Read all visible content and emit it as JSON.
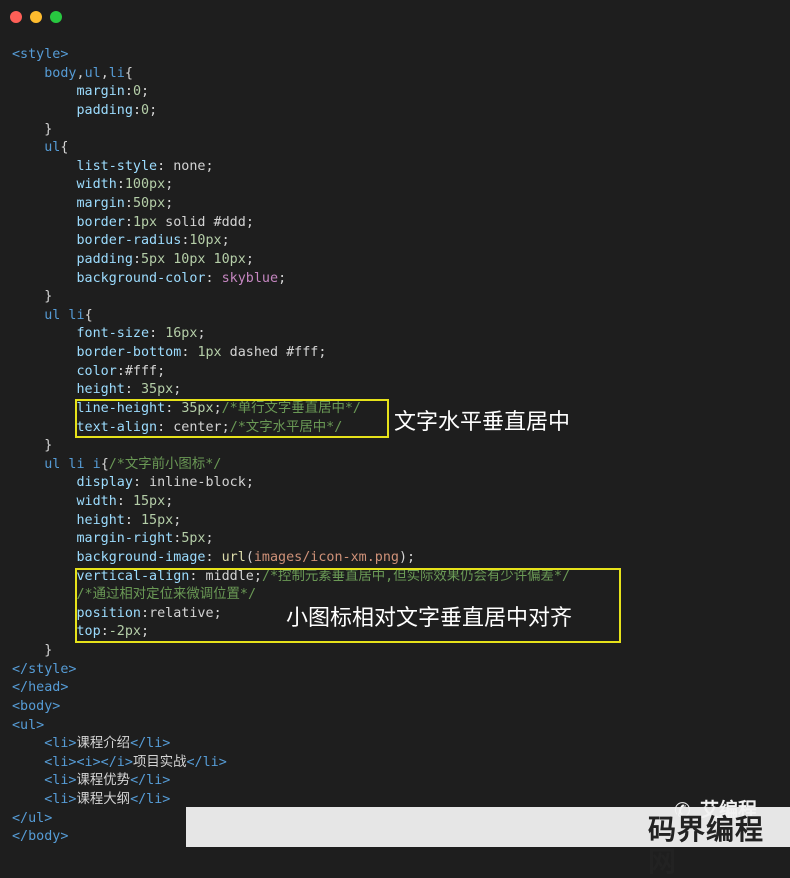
{
  "window": {
    "controls": [
      "close",
      "minimize",
      "maximize"
    ],
    "colors": {
      "close": "#fe5f57",
      "minimize": "#febc2e",
      "maximize": "#28c840",
      "background": "#1e1e1e"
    }
  },
  "code_lines": [
    [
      [
        "tag",
        "<style>"
      ]
    ],
    [
      [
        "txt",
        "    "
      ],
      [
        "sel",
        "body"
      ],
      [
        "punc",
        ","
      ],
      [
        "sel",
        "ul"
      ],
      [
        "punc",
        ","
      ],
      [
        "sel",
        "li"
      ],
      [
        "punc",
        "{"
      ]
    ],
    [
      [
        "txt",
        "        "
      ],
      [
        "prop",
        "margin"
      ],
      [
        "punc",
        ":"
      ],
      [
        "num",
        "0"
      ],
      [
        "punc",
        ";"
      ]
    ],
    [
      [
        "txt",
        "        "
      ],
      [
        "prop",
        "padding"
      ],
      [
        "punc",
        ":"
      ],
      [
        "num",
        "0"
      ],
      [
        "punc",
        ";"
      ]
    ],
    [
      [
        "txt",
        "    "
      ],
      [
        "punc",
        "}"
      ]
    ],
    [
      [
        "txt",
        "    "
      ],
      [
        "sel",
        "ul"
      ],
      [
        "punc",
        "{"
      ]
    ],
    [
      [
        "txt",
        "        "
      ],
      [
        "prop",
        "list-style"
      ],
      [
        "punc",
        ": "
      ],
      [
        "txt",
        "none"
      ],
      [
        "punc",
        ";"
      ]
    ],
    [
      [
        "txt",
        "        "
      ],
      [
        "prop",
        "width"
      ],
      [
        "punc",
        ":"
      ],
      [
        "num",
        "100px"
      ],
      [
        "punc",
        ";"
      ]
    ],
    [
      [
        "txt",
        "        "
      ],
      [
        "prop",
        "margin"
      ],
      [
        "punc",
        ":"
      ],
      [
        "num",
        "50px"
      ],
      [
        "punc",
        ";"
      ]
    ],
    [
      [
        "txt",
        "        "
      ],
      [
        "prop",
        "border"
      ],
      [
        "punc",
        ":"
      ],
      [
        "num",
        "1px"
      ],
      [
        "txt",
        " solid #ddd"
      ],
      [
        "punc",
        ";"
      ]
    ],
    [
      [
        "txt",
        "        "
      ],
      [
        "prop",
        "border-radius"
      ],
      [
        "punc",
        ":"
      ],
      [
        "num",
        "10px"
      ],
      [
        "punc",
        ";"
      ]
    ],
    [
      [
        "txt",
        "        "
      ],
      [
        "prop",
        "padding"
      ],
      [
        "punc",
        ":"
      ],
      [
        "num",
        "5px 10px 10px"
      ],
      [
        "punc",
        ";"
      ]
    ],
    [
      [
        "txt",
        "        "
      ],
      [
        "prop",
        "background-color"
      ],
      [
        "punc",
        ": "
      ],
      [
        "kw",
        "skyblue"
      ],
      [
        "punc",
        ";"
      ]
    ],
    [
      [
        "txt",
        "    "
      ],
      [
        "punc",
        "}"
      ]
    ],
    [
      [
        "txt",
        "    "
      ],
      [
        "sel",
        "ul li"
      ],
      [
        "punc",
        "{"
      ]
    ],
    [
      [
        "txt",
        "        "
      ],
      [
        "prop",
        "font-size"
      ],
      [
        "punc",
        ": "
      ],
      [
        "num",
        "16px"
      ],
      [
        "punc",
        ";"
      ]
    ],
    [
      [
        "txt",
        "        "
      ],
      [
        "prop",
        "border-bottom"
      ],
      [
        "punc",
        ": "
      ],
      [
        "num",
        "1px"
      ],
      [
        "txt",
        " dashed #fff"
      ],
      [
        "punc",
        ";"
      ]
    ],
    [
      [
        "txt",
        "        "
      ],
      [
        "prop",
        "color"
      ],
      [
        "punc",
        ":"
      ],
      [
        "txt",
        "#fff"
      ],
      [
        "punc",
        ";"
      ]
    ],
    [
      [
        "txt",
        "        "
      ],
      [
        "prop",
        "height"
      ],
      [
        "punc",
        ": "
      ],
      [
        "num",
        "35px"
      ],
      [
        "punc",
        ";"
      ]
    ],
    [
      [
        "txt",
        "        "
      ],
      [
        "prop",
        "line-height"
      ],
      [
        "punc",
        ": "
      ],
      [
        "num",
        "35px"
      ],
      [
        "punc",
        ";"
      ],
      [
        "cm",
        "/*单行文字垂直居中*/"
      ]
    ],
    [
      [
        "txt",
        "        "
      ],
      [
        "prop",
        "text-align"
      ],
      [
        "punc",
        ": "
      ],
      [
        "txt",
        "center"
      ],
      [
        "punc",
        ";"
      ],
      [
        "cm",
        "/*文字水平居中*/"
      ]
    ],
    [
      [
        "txt",
        "    "
      ],
      [
        "punc",
        "}"
      ]
    ],
    [
      [
        "txt",
        "    "
      ],
      [
        "sel",
        "ul li i"
      ],
      [
        "punc",
        "{"
      ],
      [
        "cm",
        "/*文字前小图标*/"
      ]
    ],
    [
      [
        "txt",
        "        "
      ],
      [
        "prop",
        "display"
      ],
      [
        "punc",
        ": "
      ],
      [
        "txt",
        "inline-block"
      ],
      [
        "punc",
        ";"
      ]
    ],
    [
      [
        "txt",
        "        "
      ],
      [
        "prop",
        "width"
      ],
      [
        "punc",
        ": "
      ],
      [
        "num",
        "15px"
      ],
      [
        "punc",
        ";"
      ]
    ],
    [
      [
        "txt",
        "        "
      ],
      [
        "prop",
        "height"
      ],
      [
        "punc",
        ": "
      ],
      [
        "num",
        "15px"
      ],
      [
        "punc",
        ";"
      ]
    ],
    [
      [
        "txt",
        "        "
      ],
      [
        "prop",
        "margin-right"
      ],
      [
        "punc",
        ":"
      ],
      [
        "num",
        "5px"
      ],
      [
        "punc",
        ";"
      ]
    ],
    [
      [
        "txt",
        "        "
      ],
      [
        "prop",
        "background-image"
      ],
      [
        "punc",
        ": "
      ],
      [
        "fn",
        "url"
      ],
      [
        "punc",
        "("
      ],
      [
        "str",
        "images/icon-xm.png"
      ],
      [
        "punc",
        ");"
      ]
    ],
    [
      [
        "txt",
        "        "
      ],
      [
        "prop",
        "vertical-align"
      ],
      [
        "punc",
        ": "
      ],
      [
        "txt",
        "middle"
      ],
      [
        "punc",
        ";"
      ],
      [
        "cm",
        "/*控制元素垂直居中,但实际效果仍会有少许偏差*/"
      ]
    ],
    [
      [
        "txt",
        "        "
      ],
      [
        "cm",
        "/*通过相对定位来微调位置*/"
      ]
    ],
    [
      [
        "txt",
        "        "
      ],
      [
        "prop",
        "position"
      ],
      [
        "punc",
        ":"
      ],
      [
        "txt",
        "relative"
      ],
      [
        "punc",
        ";"
      ]
    ],
    [
      [
        "txt",
        "        "
      ],
      [
        "prop",
        "top"
      ],
      [
        "punc",
        ":"
      ],
      [
        "num",
        "-2px"
      ],
      [
        "punc",
        ";"
      ]
    ],
    [
      [
        "txt",
        "    "
      ],
      [
        "punc",
        "}"
      ]
    ],
    [
      [
        "tag",
        "</style>"
      ]
    ],
    [
      [
        "tag",
        "</head>"
      ]
    ],
    [
      [
        "tag",
        "<body>"
      ]
    ],
    [
      [
        "tag",
        "<ul>"
      ]
    ],
    [
      [
        "txt",
        "    "
      ],
      [
        "tag",
        "<li>"
      ],
      [
        "txt",
        "课程介绍"
      ],
      [
        "tag",
        "</li>"
      ]
    ],
    [
      [
        "txt",
        "    "
      ],
      [
        "tag",
        "<li><i></i>"
      ],
      [
        "txt",
        "项目实战"
      ],
      [
        "tag",
        "</li>"
      ]
    ],
    [
      [
        "txt",
        "    "
      ],
      [
        "tag",
        "<li>"
      ],
      [
        "txt",
        "课程优势"
      ],
      [
        "tag",
        "</li>"
      ]
    ],
    [
      [
        "txt",
        "    "
      ],
      [
        "tag",
        "<li>"
      ],
      [
        "txt",
        "课程大纲"
      ],
      [
        "tag",
        "</li>"
      ]
    ],
    [
      [
        "tag",
        "</ul>"
      ]
    ],
    [
      [
        "tag",
        "</body>"
      ]
    ]
  ],
  "annotations": {
    "box1_label": "文字水平垂直居中",
    "box2_label": "小图标相对文字垂直居中对齐"
  },
  "watermark": {
    "top_text": "艾编程",
    "main_text": "码界编程网",
    "logo_icon": "wechat-icon"
  }
}
